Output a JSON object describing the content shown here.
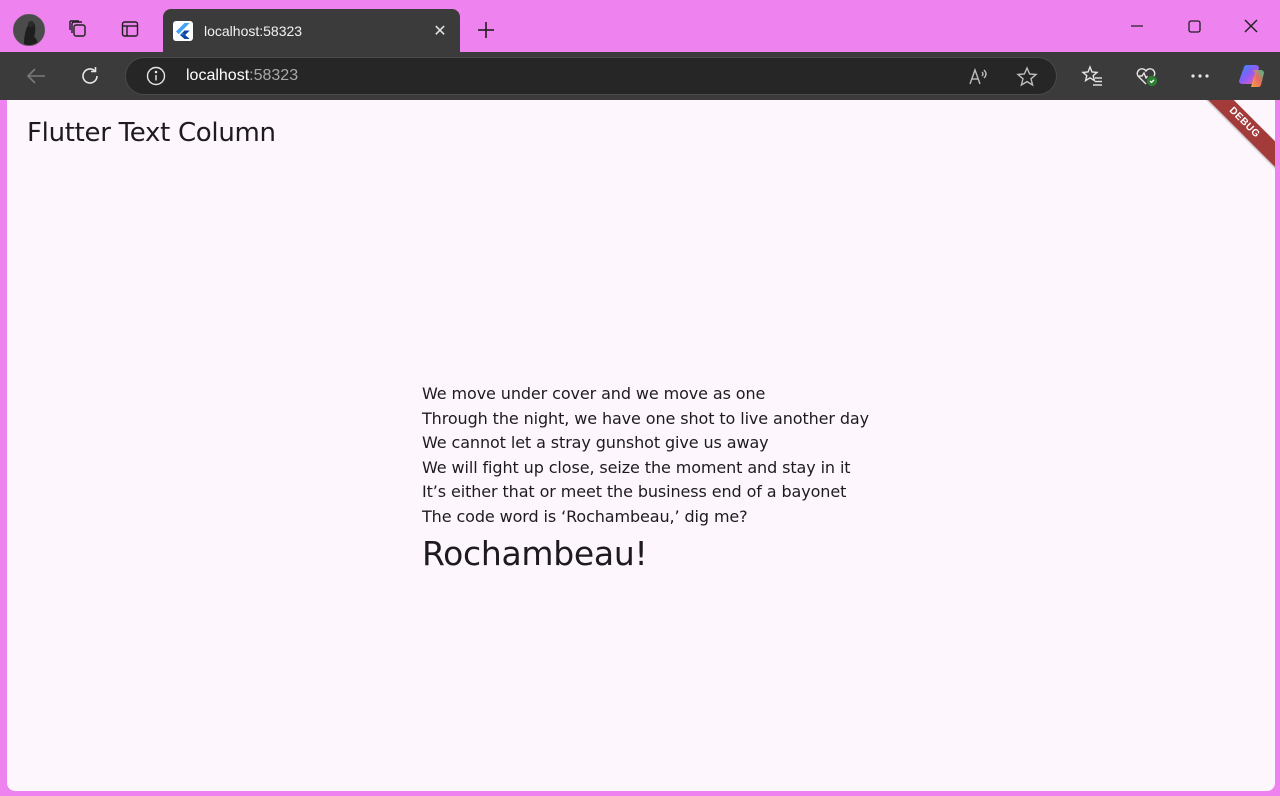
{
  "tab": {
    "title": "localhost:58323",
    "close_symbol": "✕"
  },
  "toolbar": {
    "url_host": "localhost",
    "url_port": ":58323"
  },
  "page": {
    "title": "Flutter Text Column",
    "debug_banner": "DEBUG",
    "lines": [
      "We move under cover and we move as one",
      "Through the night, we have one shot to live another day",
      "We cannot let a stray gunshot give us away",
      "We will fight up close, seize the moment and stay in it",
      "It’s either that or meet the business end of a bayonet",
      "The code word is ‘Rochambeau,’ dig me?"
    ],
    "final_line": "Rochambeau!"
  },
  "colors": {
    "frame_accent": "#ee82ee",
    "toolbar_bg": "#3b3b3b",
    "page_bg": "#fdf6fd",
    "debug_banner": "#a33b3b"
  },
  "icons": [
    "profile-avatar",
    "workspaces-icon",
    "vertical-tabs-icon",
    "flutter-favicon",
    "new-tab-icon",
    "minimize-icon",
    "maximize-icon",
    "close-window-icon",
    "back-icon",
    "refresh-icon",
    "site-info-icon",
    "read-aloud-icon",
    "favorite-star-icon",
    "favorites-icon",
    "browser-essentials-icon",
    "more-icon",
    "copilot-icon"
  ]
}
